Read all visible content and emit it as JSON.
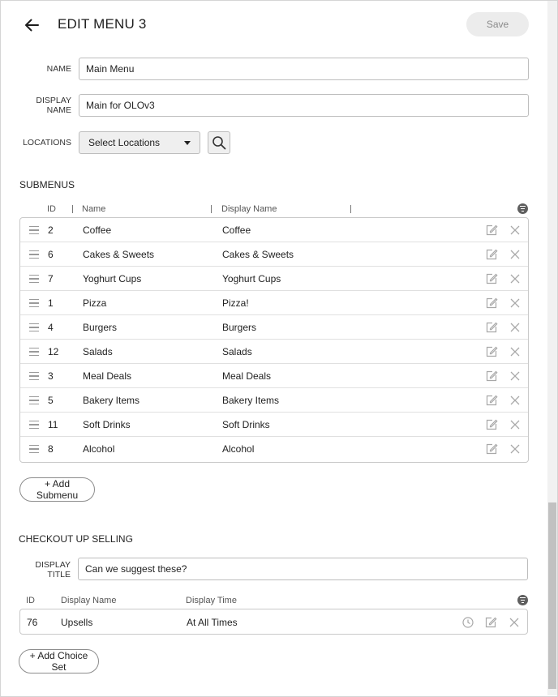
{
  "header": {
    "title": "EDIT MENU 3",
    "save_label": "Save"
  },
  "form": {
    "name_label": "NAME",
    "name_value": "Main Menu",
    "display_name_label_1": "DISPLAY",
    "display_name_label_2": "NAME",
    "display_name_value": "Main for OLOv3",
    "locations_label": "LOCATIONS",
    "locations_select": "Select Locations"
  },
  "submenus": {
    "title": "SUBMENUS",
    "columns": {
      "id": "ID",
      "name": "Name",
      "display_name": "Display Name"
    },
    "rows": [
      {
        "id": "2",
        "name": "Coffee",
        "display_name": "Coffee"
      },
      {
        "id": "6",
        "name": "Cakes & Sweets",
        "display_name": "Cakes & Sweets"
      },
      {
        "id": "7",
        "name": "Yoghurt Cups",
        "display_name": "Yoghurt Cups"
      },
      {
        "id": "1",
        "name": "Pizza",
        "display_name": "Pizza!"
      },
      {
        "id": "4",
        "name": "Burgers",
        "display_name": "Burgers"
      },
      {
        "id": "12",
        "name": "Salads",
        "display_name": "Salads"
      },
      {
        "id": "3",
        "name": "Meal Deals",
        "display_name": "Meal Deals"
      },
      {
        "id": "5",
        "name": "Bakery Items",
        "display_name": "Bakery Items"
      },
      {
        "id": "11",
        "name": "Soft Drinks",
        "display_name": "Soft Drinks"
      },
      {
        "id": "8",
        "name": "Alcohol",
        "display_name": "Alcohol"
      }
    ],
    "add_label": "+ Add Submenu"
  },
  "checkout": {
    "title": "CHECKOUT UP SELLING",
    "display_title_label_1": "DISPLAY",
    "display_title_label_2": "TITLE",
    "display_title_value": "Can we suggest these?",
    "columns": {
      "id": "ID",
      "display_name": "Display Name",
      "display_time": "Display Time"
    },
    "rows": [
      {
        "id": "76",
        "display_name": "Upsells",
        "display_time": "At All Times"
      }
    ],
    "add_label": "+ Add Choice Set"
  },
  "colors": {
    "border": "#c9c9c9",
    "icon_gray": "#a8a8a8",
    "save_bg": "#ececec"
  }
}
